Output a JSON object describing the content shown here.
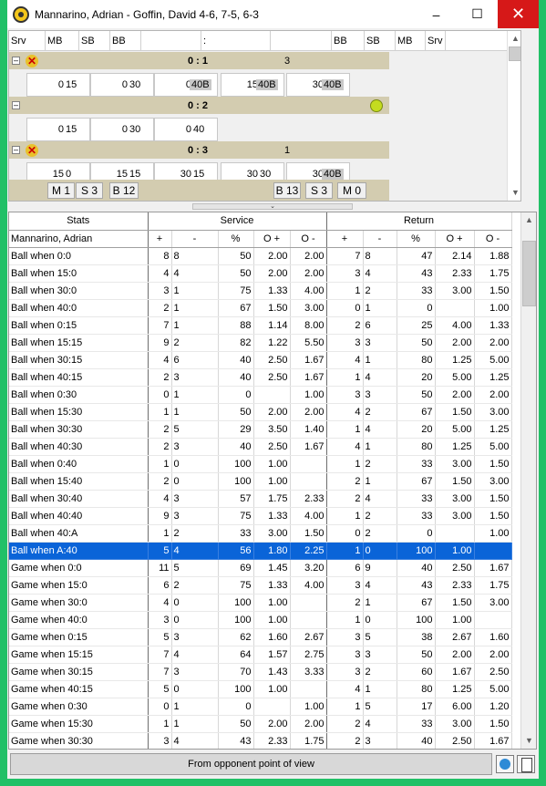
{
  "window": {
    "title": "Mannarino, Adrian - Goffin, David 4-6, 7-5, 6-3",
    "minimize": "–",
    "maximize": "☐",
    "close": "✕"
  },
  "score_header": [
    "Srv",
    "MB",
    "SB",
    "BB",
    "",
    ":",
    "",
    "BB",
    "SB",
    "MB",
    "Srv"
  ],
  "sets": [
    {
      "toggle": "–",
      "score": "0 : 1",
      "games": "3",
      "has_x": true,
      "has_ball": false,
      "points": [
        {
          "a": "0",
          "b": "15"
        },
        {
          "a": "0",
          "b": "30"
        },
        {
          "a": "0",
          "b": "40B",
          "hl": true
        },
        {
          "a": "15",
          "b": "40B",
          "hl": true
        },
        {
          "a": "30",
          "b": "40B",
          "hl": true
        }
      ]
    },
    {
      "toggle": "–",
      "score": "0 : 2",
      "games": "",
      "has_x": false,
      "has_ball": true,
      "points": [
        {
          "a": "0",
          "b": "15"
        },
        {
          "a": "0",
          "b": "30"
        },
        {
          "a": "0",
          "b": "40"
        }
      ]
    },
    {
      "toggle": "–",
      "score": "0 : 3",
      "games": "1",
      "has_x": true,
      "has_ball": false,
      "points": [
        {
          "a": "15",
          "b": "0"
        },
        {
          "a": "15",
          "b": "15"
        },
        {
          "a": "30",
          "b": "15"
        },
        {
          "a": "30",
          "b": "30"
        },
        {
          "a": "30",
          "b": "40B",
          "hl": true
        }
      ]
    }
  ],
  "summary": {
    "left": [
      "M 1",
      "S 3",
      "B 12"
    ],
    "right": [
      "B 13",
      "S 3",
      "M 0"
    ]
  },
  "stats": {
    "group_header": {
      "stats": "Stats",
      "service": "Service",
      "return": "Return"
    },
    "player": "Mannarino, Adrian",
    "columns": [
      "+",
      "-",
      "%",
      "O +",
      "O -",
      "+",
      "-",
      "%",
      "O +",
      "O -"
    ],
    "selected_row": "Ball when A:40",
    "rows": [
      [
        "Ball when 0:0",
        "8",
        "8",
        "50",
        "2.00",
        "2.00",
        "7",
        "8",
        "47",
        "2.14",
        "1.88"
      ],
      [
        "Ball when 15:0",
        "4",
        "4",
        "50",
        "2.00",
        "2.00",
        "3",
        "4",
        "43",
        "2.33",
        "1.75"
      ],
      [
        "Ball when 30:0",
        "3",
        "1",
        "75",
        "1.33",
        "4.00",
        "1",
        "2",
        "33",
        "3.00",
        "1.50"
      ],
      [
        "Ball when 40:0",
        "2",
        "1",
        "67",
        "1.50",
        "3.00",
        "0",
        "1",
        "0",
        "",
        "1.00"
      ],
      [
        "Ball when 0:15",
        "7",
        "1",
        "88",
        "1.14",
        "8.00",
        "2",
        "6",
        "25",
        "4.00",
        "1.33"
      ],
      [
        "Ball when 15:15",
        "9",
        "2",
        "82",
        "1.22",
        "5.50",
        "3",
        "3",
        "50",
        "2.00",
        "2.00"
      ],
      [
        "Ball when 30:15",
        "4",
        "6",
        "40",
        "2.50",
        "1.67",
        "4",
        "1",
        "80",
        "1.25",
        "5.00"
      ],
      [
        "Ball when 40:15",
        "2",
        "3",
        "40",
        "2.50",
        "1.67",
        "1",
        "4",
        "20",
        "5.00",
        "1.25"
      ],
      [
        "Ball when 0:30",
        "0",
        "1",
        "0",
        "",
        "1.00",
        "3",
        "3",
        "50",
        "2.00",
        "2.00"
      ],
      [
        "Ball when 15:30",
        "1",
        "1",
        "50",
        "2.00",
        "2.00",
        "4",
        "2",
        "67",
        "1.50",
        "3.00"
      ],
      [
        "Ball when 30:30",
        "2",
        "5",
        "29",
        "3.50",
        "1.40",
        "1",
        "4",
        "20",
        "5.00",
        "1.25"
      ],
      [
        "Ball when 40:30",
        "2",
        "3",
        "40",
        "2.50",
        "1.67",
        "4",
        "1",
        "80",
        "1.25",
        "5.00"
      ],
      [
        "Ball when 0:40",
        "1",
        "0",
        "100",
        "1.00",
        "",
        "1",
        "2",
        "33",
        "3.00",
        "1.50"
      ],
      [
        "Ball when 15:40",
        "2",
        "0",
        "100",
        "1.00",
        "",
        "2",
        "1",
        "67",
        "1.50",
        "3.00"
      ],
      [
        "Ball when 30:40",
        "4",
        "3",
        "57",
        "1.75",
        "2.33",
        "2",
        "4",
        "33",
        "3.00",
        "1.50"
      ],
      [
        "Ball when 40:40",
        "9",
        "3",
        "75",
        "1.33",
        "4.00",
        "1",
        "2",
        "33",
        "3.00",
        "1.50"
      ],
      [
        "Ball when 40:A",
        "1",
        "2",
        "33",
        "3.00",
        "1.50",
        "0",
        "2",
        "0",
        "",
        "1.00"
      ],
      [
        "Ball when A:40",
        "5",
        "4",
        "56",
        "1.80",
        "2.25",
        "1",
        "0",
        "100",
        "1.00",
        ""
      ],
      [
        "Game when 0:0",
        "11",
        "5",
        "69",
        "1.45",
        "3.20",
        "6",
        "9",
        "40",
        "2.50",
        "1.67"
      ],
      [
        "Game when 15:0",
        "6",
        "2",
        "75",
        "1.33",
        "4.00",
        "3",
        "4",
        "43",
        "2.33",
        "1.75"
      ],
      [
        "Game when 30:0",
        "4",
        "0",
        "100",
        "1.00",
        "",
        "2",
        "1",
        "67",
        "1.50",
        "3.00"
      ],
      [
        "Game when 40:0",
        "3",
        "0",
        "100",
        "1.00",
        "",
        "1",
        "0",
        "100",
        "1.00",
        ""
      ],
      [
        "Game when 0:15",
        "5",
        "3",
        "62",
        "1.60",
        "2.67",
        "3",
        "5",
        "38",
        "2.67",
        "1.60"
      ],
      [
        "Game when 15:15",
        "7",
        "4",
        "64",
        "1.57",
        "2.75",
        "3",
        "3",
        "50",
        "2.00",
        "2.00"
      ],
      [
        "Game when 30:15",
        "7",
        "3",
        "70",
        "1.43",
        "3.33",
        "3",
        "2",
        "60",
        "1.67",
        "2.50"
      ],
      [
        "Game when 40:15",
        "5",
        "0",
        "100",
        "1.00",
        "",
        "4",
        "1",
        "80",
        "1.25",
        "5.00"
      ],
      [
        "Game when 0:30",
        "0",
        "1",
        "0",
        "",
        "1.00",
        "1",
        "5",
        "17",
        "6.00",
        "1.20"
      ],
      [
        "Game when 15:30",
        "1",
        "1",
        "50",
        "2.00",
        "2.00",
        "2",
        "4",
        "33",
        "3.00",
        "1.50"
      ],
      [
        "Game when 30:30",
        "3",
        "4",
        "43",
        "2.33",
        "1.75",
        "2",
        "3",
        "40",
        "2.50",
        "1.67"
      ]
    ]
  },
  "footer": {
    "label": "From opponent point of view"
  },
  "colors": {
    "frame": "#21c067",
    "selection": "#0a64d8",
    "set_bar": "#d3ccb0"
  }
}
